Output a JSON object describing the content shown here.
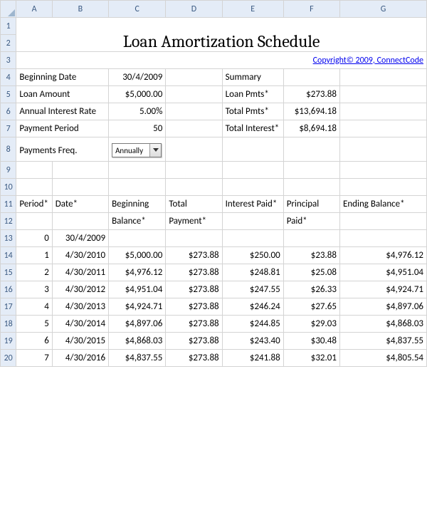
{
  "columns": [
    "A",
    "B",
    "C",
    "D",
    "E",
    "F",
    "G"
  ],
  "rows": [
    "1",
    "2",
    "3",
    "4",
    "5",
    "6",
    "7",
    "8",
    "9",
    "10",
    "11",
    "12",
    "13",
    "14",
    "15",
    "16",
    "17",
    "18",
    "19",
    "20"
  ],
  "title": "Loan Amortization Schedule",
  "copyright": "Copyright© 2009, ConnectCode",
  "inputs": {
    "beginning_date_label": "Beginning Date",
    "beginning_date": "30/4/2009",
    "loan_amount_label": "Loan Amount",
    "loan_amount": "$5,000.00",
    "rate_label": "Annual Interest Rate",
    "rate": "5.00%",
    "period_label": "Payment Period",
    "period": "50",
    "freq_label": "Payments Freq.",
    "freq_value": "Annually"
  },
  "summary": {
    "header": "Summary",
    "loan_pmts_label": "Loan Pmts*",
    "loan_pmts": "$273.88",
    "total_pmts_label": "Total Pmts*",
    "total_pmts": "$13,694.18",
    "total_interest_label": "Total Interest*",
    "total_interest": "$8,694.18"
  },
  "headers": {
    "period": "Period*",
    "date": "Date*",
    "begbal1": "Beginning",
    "begbal2": "Balance*",
    "totpay1": "Total",
    "totpay2": "Payment*",
    "intpaid": "Interest Paid*",
    "prinpaid1": "Principal",
    "prinpaid2": "Paid*",
    "endbal": "Ending Balance*"
  },
  "schedule": [
    {
      "period": "0",
      "date": "30/4/2009",
      "beg": "",
      "pay": "",
      "int": "",
      "prin": "",
      "end": ""
    },
    {
      "period": "1",
      "date": "4/30/2010",
      "beg": "$5,000.00",
      "pay": "$273.88",
      "int": "$250.00",
      "prin": "$23.88",
      "end": "$4,976.12"
    },
    {
      "period": "2",
      "date": "4/30/2011",
      "beg": "$4,976.12",
      "pay": "$273.88",
      "int": "$248.81",
      "prin": "$25.08",
      "end": "$4,951.04"
    },
    {
      "period": "3",
      "date": "4/30/2012",
      "beg": "$4,951.04",
      "pay": "$273.88",
      "int": "$247.55",
      "prin": "$26.33",
      "end": "$4,924.71"
    },
    {
      "period": "4",
      "date": "4/30/2013",
      "beg": "$4,924.71",
      "pay": "$273.88",
      "int": "$246.24",
      "prin": "$27.65",
      "end": "$4,897.06"
    },
    {
      "period": "5",
      "date": "4/30/2014",
      "beg": "$4,897.06",
      "pay": "$273.88",
      "int": "$244.85",
      "prin": "$29.03",
      "end": "$4,868.03"
    },
    {
      "period": "6",
      "date": "4/30/2015",
      "beg": "$4,868.03",
      "pay": "$273.88",
      "int": "$243.40",
      "prin": "$30.48",
      "end": "$4,837.55"
    },
    {
      "period": "7",
      "date": "4/30/2016",
      "beg": "$4,837.55",
      "pay": "$273.88",
      "int": "$241.88",
      "prin": "$32.01",
      "end": "$4,805.54"
    }
  ]
}
